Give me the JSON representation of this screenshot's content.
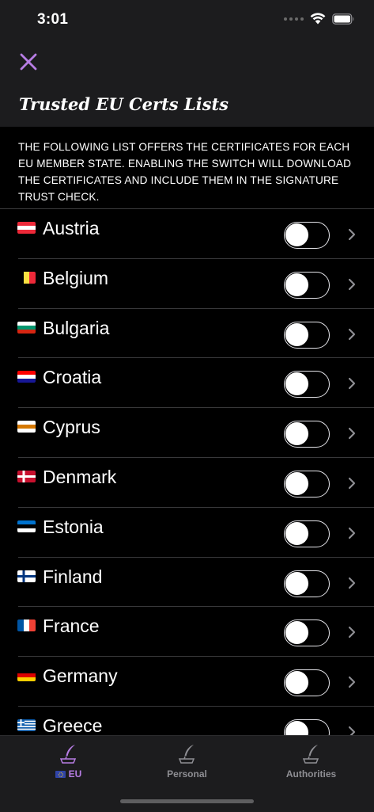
{
  "status_bar": {
    "time": "3:01",
    "icons": [
      "signal-dots-icon",
      "wifi-icon",
      "battery-icon"
    ]
  },
  "header": {
    "close_icon": "close-icon",
    "title": "Trusted EU Certs Lists"
  },
  "description": "THE FOLLOWING LIST OFFERS THE CERTIFICATES FOR EACH EU MEMBER STATE. ENABLING THE SWITCH WILL DOWNLOAD THE CERTIFICATES AND INCLUDE THEM IN THE SIGNATURE TRUST CHECK.",
  "countries": [
    {
      "name": "Austria",
      "enabled": false,
      "flag": {
        "dir": "h",
        "colors": [
          "#ed2939",
          "#ffffff",
          "#ed2939"
        ]
      }
    },
    {
      "name": "Belgium",
      "enabled": false,
      "flag": {
        "dir": "v",
        "colors": [
          "#000000",
          "#fae042",
          "#ed2939"
        ]
      }
    },
    {
      "name": "Bulgaria",
      "enabled": false,
      "flag": {
        "dir": "h",
        "colors": [
          "#ffffff",
          "#00966e",
          "#d62612"
        ]
      }
    },
    {
      "name": "Croatia",
      "enabled": false,
      "flag": {
        "dir": "h",
        "colors": [
          "#ff0000",
          "#ffffff",
          "#171796"
        ]
      }
    },
    {
      "name": "Cyprus",
      "enabled": false,
      "flag": {
        "dir": "h",
        "colors": [
          "#ffffff",
          "#d57800",
          "#ffffff"
        ]
      }
    },
    {
      "name": "Denmark",
      "enabled": false,
      "flag": {
        "dir": "cross",
        "colors": [
          "#c8102e",
          "#ffffff"
        ]
      }
    },
    {
      "name": "Estonia",
      "enabled": false,
      "flag": {
        "dir": "h",
        "colors": [
          "#0072ce",
          "#000000",
          "#ffffff"
        ]
      }
    },
    {
      "name": "Finland",
      "enabled": false,
      "flag": {
        "dir": "cross",
        "colors": [
          "#ffffff",
          "#003580"
        ]
      }
    },
    {
      "name": "France",
      "enabled": false,
      "flag": {
        "dir": "v",
        "colors": [
          "#0055a4",
          "#ffffff",
          "#ef4135"
        ]
      }
    },
    {
      "name": "Germany",
      "enabled": false,
      "flag": {
        "dir": "h",
        "colors": [
          "#000000",
          "#dd0000",
          "#ffce00"
        ]
      }
    },
    {
      "name": "Greece",
      "enabled": false,
      "flag": {
        "dir": "stripes",
        "colors": [
          "#0d5eaf",
          "#ffffff"
        ]
      }
    }
  ],
  "tab_bar": {
    "active": "EU",
    "tabs": [
      {
        "label": "EU",
        "icon": "quill-ink-icon"
      },
      {
        "label": "Personal",
        "icon": "quill-ink-icon"
      },
      {
        "label": "Authorities",
        "icon": "quill-ink-icon"
      }
    ]
  },
  "colors": {
    "accent": "#b77de4",
    "background": "#000000",
    "bar_background": "#1c1c1e",
    "inactive_tab": "#8e8e93"
  }
}
